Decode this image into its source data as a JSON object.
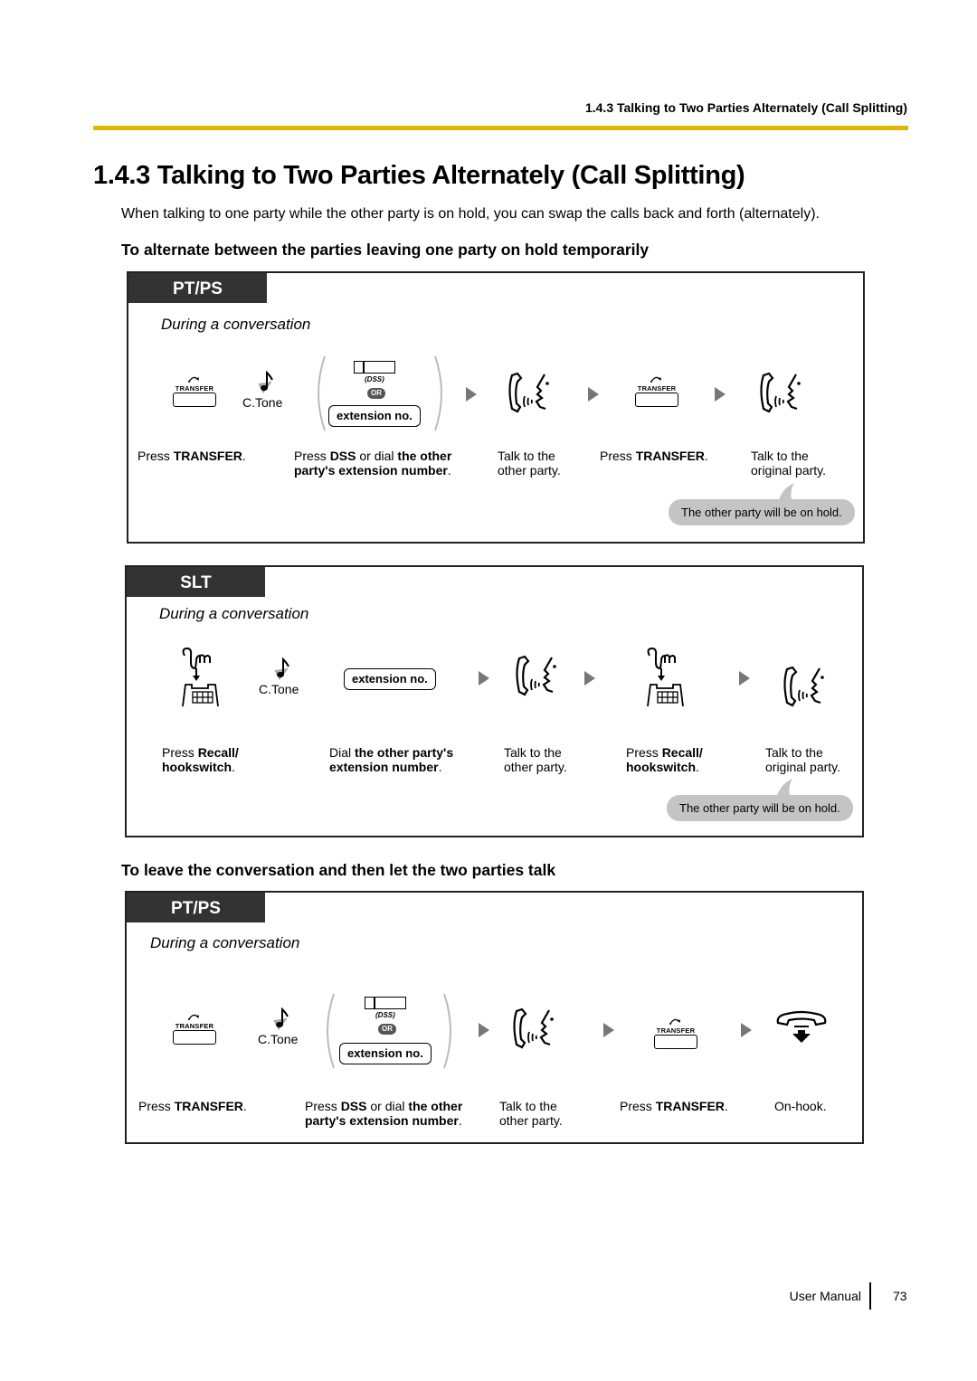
{
  "page": {
    "running_head": "1.4.3 Talking to Two Parties Alternately (Call Splitting)",
    "title": "1.4.3  Talking to Two Parties Alternately (Call Splitting)",
    "intro": "When talking to one party while the other party is on hold, you can swap the calls back and forth (alternately).",
    "accent_color": "#e0b800",
    "footer": {
      "label": "User Manual",
      "page_number": "73"
    }
  },
  "sections": [
    {
      "heading": "To alternate between the parties leaving one party on hold temporarily",
      "panels": [
        {
          "tag": "PT/PS",
          "context": "During a conversation",
          "icons": {
            "transfer_key_label": "TRANSFER",
            "ctone_label": "C.Tone",
            "dss_label": "(DSS)",
            "or_label": "OR",
            "extension_label": "extension no."
          },
          "steps": [
            {
              "icon": "transfer-key-icon",
              "pre": "Press ",
              "bold": "TRANSFER",
              "post": "."
            },
            {
              "icon": "dss-or-extension",
              "pre": "Press ",
              "bold": "DSS",
              "mid": " or dial ",
              "bold2": "the other party's extension number",
              "post": "."
            },
            {
              "icon": "talk-icon",
              "line1": "Talk to the",
              "line2": "other party."
            },
            {
              "icon": "transfer-key-icon",
              "pre": "Press ",
              "bold": "TRANSFER",
              "post": "."
            },
            {
              "icon": "talk-icon",
              "line1": "Talk to the",
              "line2": "original party."
            }
          ],
          "note": "The other party will be on hold."
        },
        {
          "tag": "SLT",
          "context": "During a conversation",
          "icons": {
            "ctone_label": "C.Tone",
            "extension_label": "extension no."
          },
          "steps": [
            {
              "icon": "hookswitch-icon",
              "pre": "Press ",
              "bold": "Recall/",
              "bold_line2": "hookswitch",
              "post": "."
            },
            {
              "icon": "extension-button",
              "pre": "Dial ",
              "bold": "the other party's",
              "bold_line2": "extension number",
              "post": "."
            },
            {
              "icon": "talk-icon",
              "line1": "Talk to the",
              "line2": "other party."
            },
            {
              "icon": "hookswitch-icon",
              "pre": "Press ",
              "bold": "Recall/",
              "bold_line2": "hookswitch",
              "post": "."
            },
            {
              "icon": "talk-icon",
              "line1": "Talk to the",
              "line2": "original party."
            }
          ],
          "note": "The other party will be on hold."
        }
      ]
    },
    {
      "heading": "To leave the conversation and then let the two parties talk",
      "panels": [
        {
          "tag": "PT/PS",
          "context": "During a conversation",
          "icons": {
            "transfer_key_label": "TRANSFER",
            "ctone_label": "C.Tone",
            "dss_label": "(DSS)",
            "or_label": "OR",
            "extension_label": "extension no."
          },
          "steps": [
            {
              "icon": "transfer-key-icon",
              "pre": "Press ",
              "bold": "TRANSFER",
              "post": "."
            },
            {
              "icon": "dss-or-extension",
              "pre": "Press ",
              "bold": "DSS",
              "mid": " or dial ",
              "bold2": "the other party's extension number",
              "post": "."
            },
            {
              "icon": "talk-icon",
              "line1": "Talk to the",
              "line2": "other party."
            },
            {
              "icon": "transfer-key-icon",
              "pre": "Press ",
              "bold": "TRANSFER",
              "post": "."
            },
            {
              "icon": "on-hook-icon",
              "line1": "On-hook."
            }
          ]
        }
      ]
    }
  ]
}
